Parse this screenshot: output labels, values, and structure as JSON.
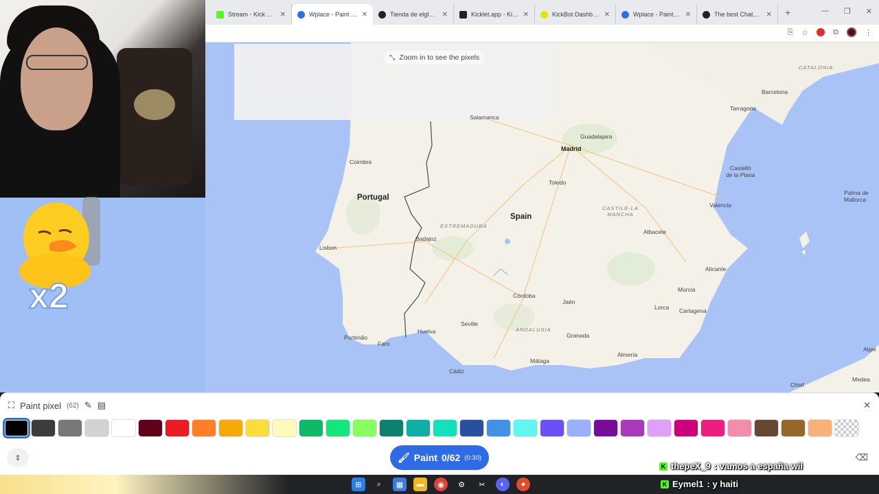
{
  "webcam": {
    "label": "streamer webcam"
  },
  "sticker": {
    "text": "x2"
  },
  "browser": {
    "tabs": [
      {
        "title": "Stream - Kick Dashb",
        "color": "#53fc18",
        "active": false
      },
      {
        "title": "Wplace - Paint the",
        "color": "#2f6fe4",
        "active": true
      },
      {
        "title": "Tienda de elglogloi",
        "color": "#222222",
        "active": false
      },
      {
        "title": "Kicklet.app - Kick C",
        "color": "#222222",
        "active": false
      },
      {
        "title": "KickBot Dashboard",
        "color": "#e6e600",
        "active": false
      },
      {
        "title": "Wplace - Paint the",
        "color": "#2f6fe4",
        "active": false
      },
      {
        "title": "The best ChatBot a",
        "color": "#222222",
        "active": false
      }
    ],
    "new_tab": "+"
  },
  "map": {
    "zoom_hint": "Zoom in to see the pixels",
    "labels": {
      "salamanca": "Salamanca",
      "madrid": "Madrid",
      "guadalajara": "Guadalajara",
      "catalonia": "CATALONIA",
      "barcelona": "Barcelona",
      "tarragona": "Tarragona",
      "coimbra": "Coimbra",
      "toledo": "Toledo",
      "castellon": "Castelló\nde la Plana",
      "palma": "Palma de\nMallorca",
      "portugal": "Portugal",
      "spain": "Spain",
      "castilla": "CASTILE-LA\nMANCHA",
      "valencia": "Valencia",
      "extremadura": "EXTREMADURA",
      "lisbon": "Lisbon",
      "badajoz": "Badajoz",
      "albacete": "Albacete",
      "alicante": "Alicante",
      "murcia": "Murcia",
      "cordoba": "Córdoba",
      "jaen": "Jaén",
      "lorca": "Lorca",
      "cartagena": "Cartagena",
      "seville": "Seville",
      "andalusia": "ANDALUSIA",
      "huelva": "Huelva",
      "portimao": "Portimão",
      "faro": "Faro",
      "granada": "Granada",
      "almeria": "Almería",
      "malaga": "Málaga",
      "cadiz": "Cádiz",
      "algeria": "Algie",
      "medea": "Medea",
      "chlef": "Chlef"
    }
  },
  "panel": {
    "title": "Paint pixel",
    "count": "(62)",
    "paint_label": "Paint",
    "paint_count": "0/62",
    "paint_timer": "(0:30)",
    "colors": [
      "#000000",
      "#3c3c3c",
      "#787878",
      "#d2d2d2",
      "#ffffff",
      "#600018",
      "#ed1c24",
      "#ff7f27",
      "#f6aa09",
      "#f9dd3b",
      "#fffabc",
      "#0eb968",
      "#13e67b",
      "#87ff5e",
      "#0c816e",
      "#10aea6",
      "#13e1be",
      "#28509e",
      "#4093e4",
      "#60f7f2",
      "#6b50f6",
      "#99b1fb",
      "#780c99",
      "#aa38b9",
      "#e09ff9",
      "#cb007a",
      "#ec1f80",
      "#f38da9",
      "#684634",
      "#95682a",
      "#f8b277",
      "transparent"
    ]
  },
  "chat": [
    {
      "user": "thepeX_9",
      "message": ": vamos a españa wil"
    },
    {
      "user": "Eymel1",
      "message": ": y haiti"
    }
  ]
}
